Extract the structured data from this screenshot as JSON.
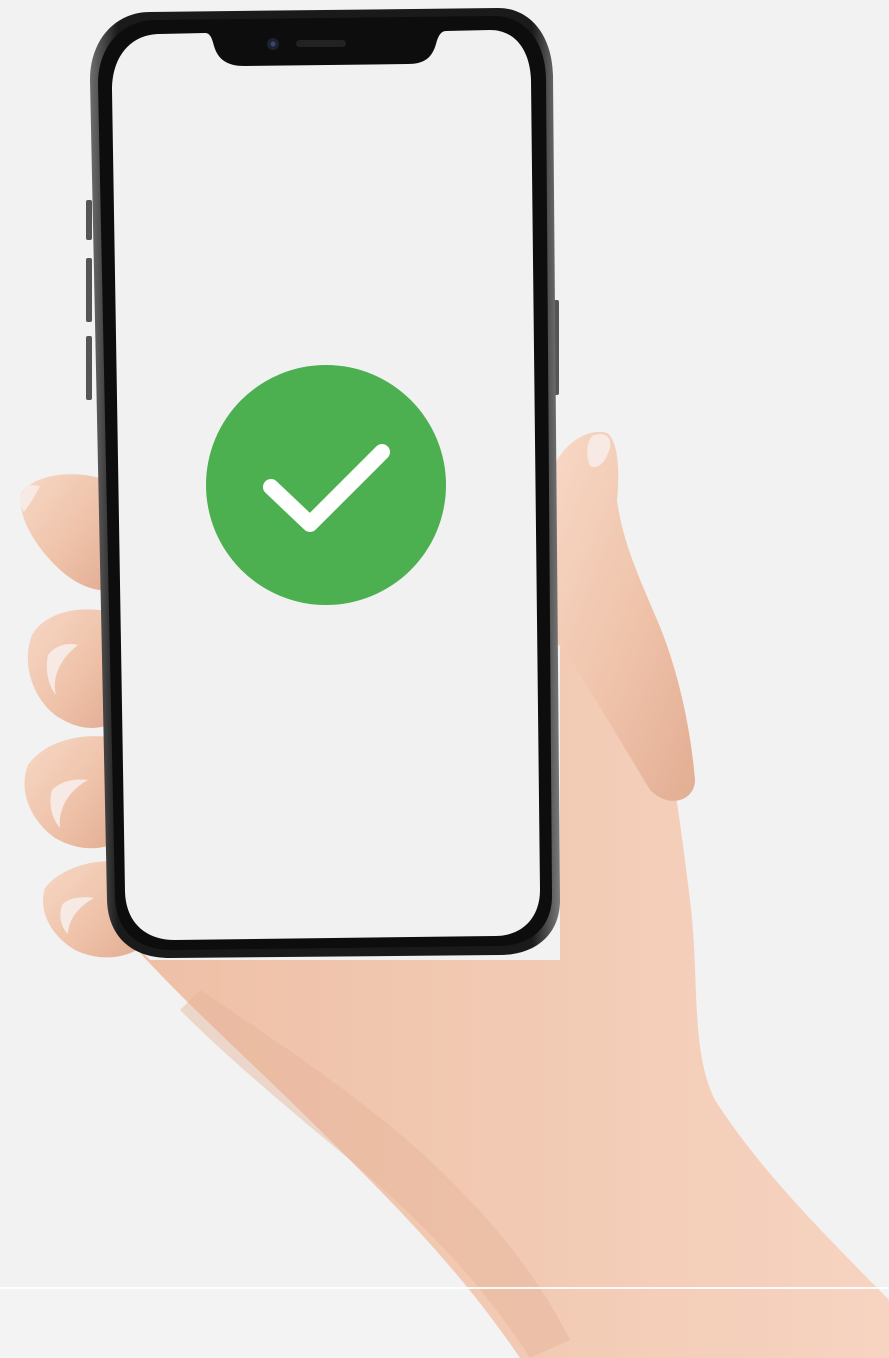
{
  "scene": {
    "background_color": "#f2f2f2",
    "screen_color": "#f1f1f1",
    "phone_frame_color": "#0d0d0d",
    "bezel_highlight_color": "#8a8a8a",
    "skin_color": "#f2cdb8",
    "skin_shadow_color": "#dba88f",
    "nail_color": "#f7eae4"
  },
  "status_indicator": {
    "icon": "checkmark-icon",
    "state": "success",
    "circle_color": "#4caf50",
    "check_color": "#ffffff"
  }
}
